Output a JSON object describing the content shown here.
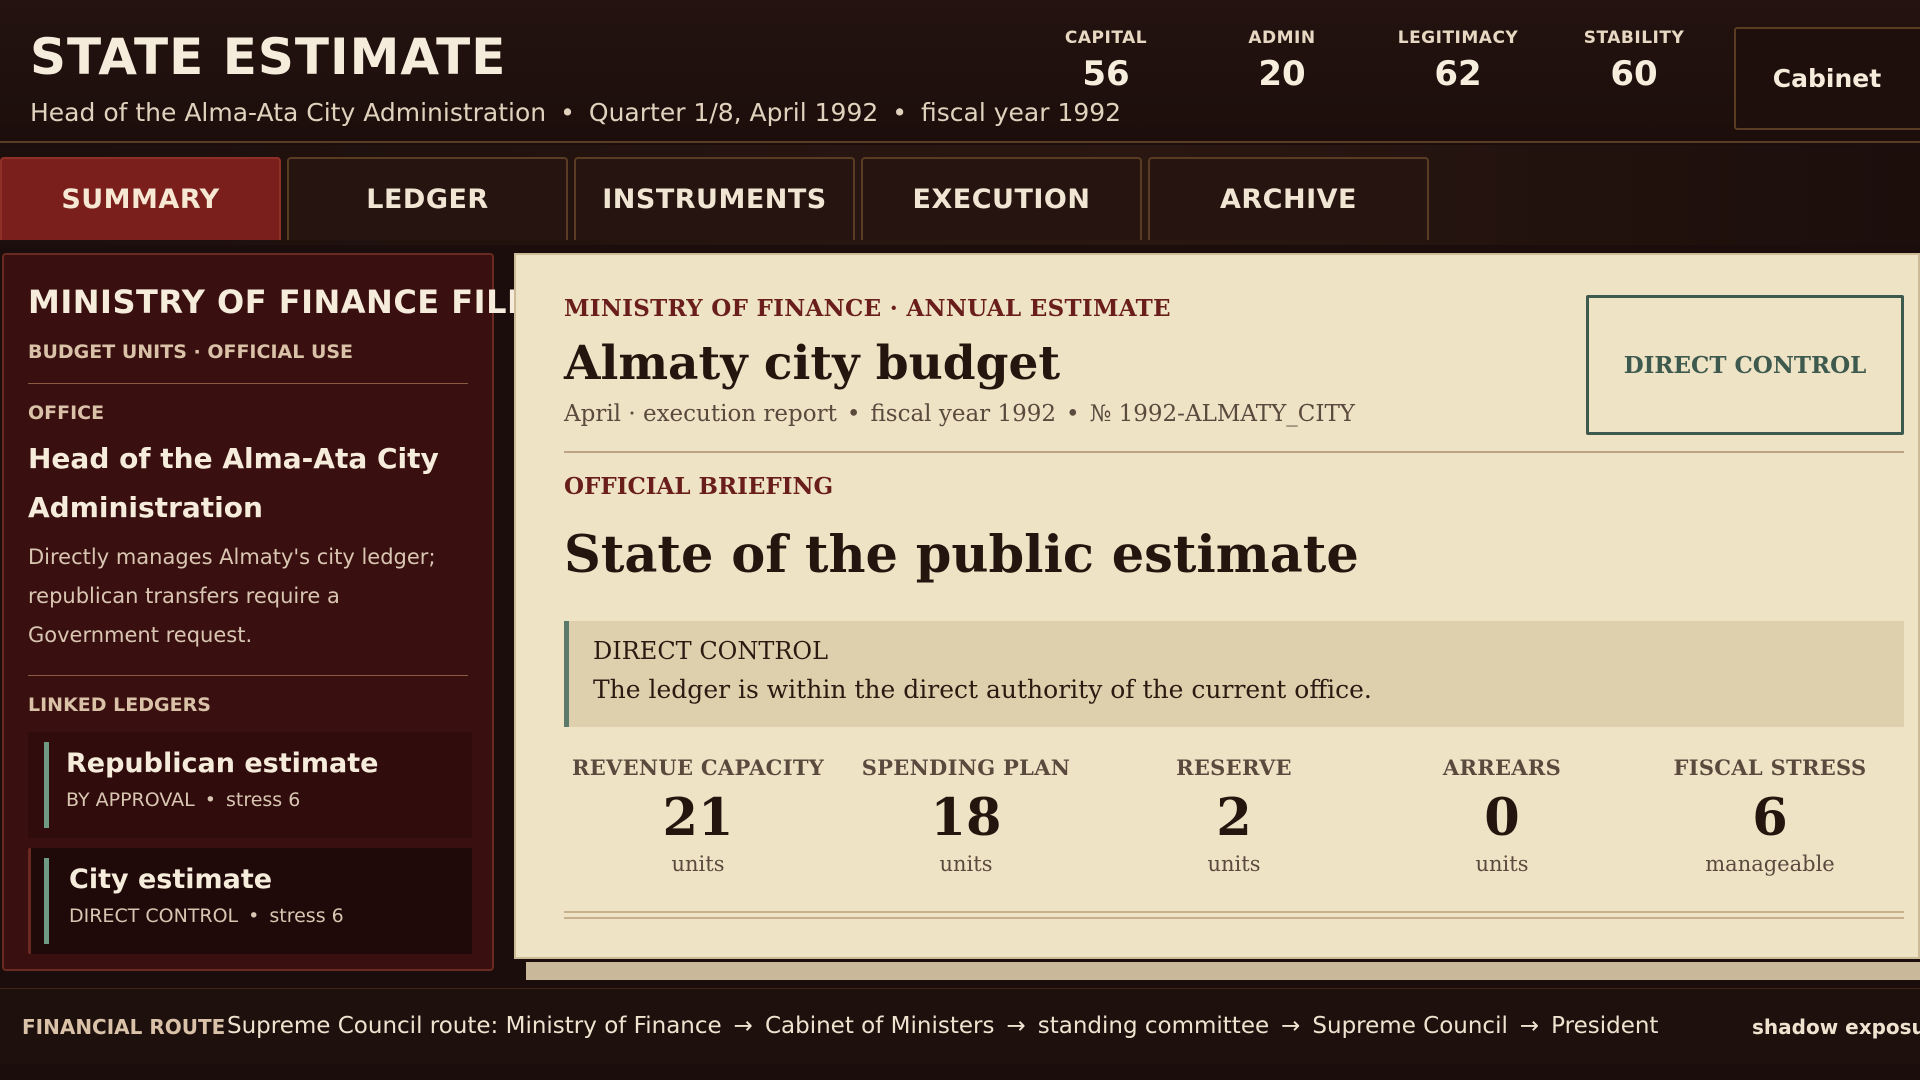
{
  "header": {
    "title": "STATE ESTIMATE",
    "office": "Head of the Alma-Ata City Administration",
    "quarter": "Quarter 1/8, April 1992",
    "fiscal_year": "fiscal year 1992",
    "separator": "•",
    "stats": [
      {
        "label": "CAPITAL",
        "value": "56"
      },
      {
        "label": "ADMIN",
        "value": "20"
      },
      {
        "label": "LEGITIMACY",
        "value": "62"
      },
      {
        "label": "STABILITY",
        "value": "60"
      }
    ],
    "cabinet_label": "Cabinet"
  },
  "tabs": [
    {
      "label": "SUMMARY",
      "active": true
    },
    {
      "label": "LEDGER",
      "active": false
    },
    {
      "label": "INSTRUMENTS",
      "active": false
    },
    {
      "label": "EXECUTION",
      "active": false
    },
    {
      "label": "ARCHIVE",
      "active": false
    }
  ],
  "sidebar": {
    "title": "MINISTRY OF FINANCE FILE",
    "subtitle": "BUDGET UNITS · OFFICIAL USE",
    "office_label": "OFFICE",
    "office_name": "Head of the Alma-Ata City Administration",
    "office_description": "Directly manages Almaty's city ledger; republican transfers require a Government request.",
    "linked_label": "LINKED LEDGERS",
    "ledgers": [
      {
        "name": "Republican estimate",
        "mode": "BY APPROVAL",
        "stress": "stress 6",
        "selected": false
      },
      {
        "name": "City estimate",
        "mode": "DIRECT CONTROL",
        "stress": "stress 6",
        "selected": true
      }
    ]
  },
  "main": {
    "eyebrow": "MINISTRY OF FINANCE · ANNUAL ESTIMATE",
    "title": "Almaty city budget",
    "report": "April · execution report",
    "fiscal_year": "fiscal year 1992",
    "number": "№ 1992-ALMATY_CITY",
    "control_badge": "DIRECT CONTROL",
    "briefing_label": "OFFICIAL BRIEFING",
    "headline": "State of the public estimate",
    "note": {
      "heading": "DIRECT CONTROL",
      "body": "The ledger is within the direct authority of the current office."
    },
    "metrics": [
      {
        "label": "REVENUE CAPACITY",
        "value": "21",
        "unit": "units"
      },
      {
        "label": "SPENDING PLAN",
        "value": "18",
        "unit": "units"
      },
      {
        "label": "RESERVE",
        "value": "2",
        "unit": "units"
      },
      {
        "label": "ARREARS",
        "value": "0",
        "unit": "units"
      },
      {
        "label": "FISCAL STRESS",
        "value": "6",
        "unit": "manageable"
      }
    ]
  },
  "footer": {
    "label": "FINANCIAL ROUTE",
    "route_prefix": "Supreme Council route:",
    "route": [
      "Ministry of Finance",
      "Cabinet of Ministers",
      "standing committee",
      "Supreme Council",
      "President"
    ],
    "arrow": "→",
    "right_label": "shadow exposure"
  },
  "colors": {
    "accent_red": "#7a1f1c",
    "panel_red": "#3a0f0f",
    "paper": "#efe3c6",
    "control_green": "#3e5a4e"
  }
}
